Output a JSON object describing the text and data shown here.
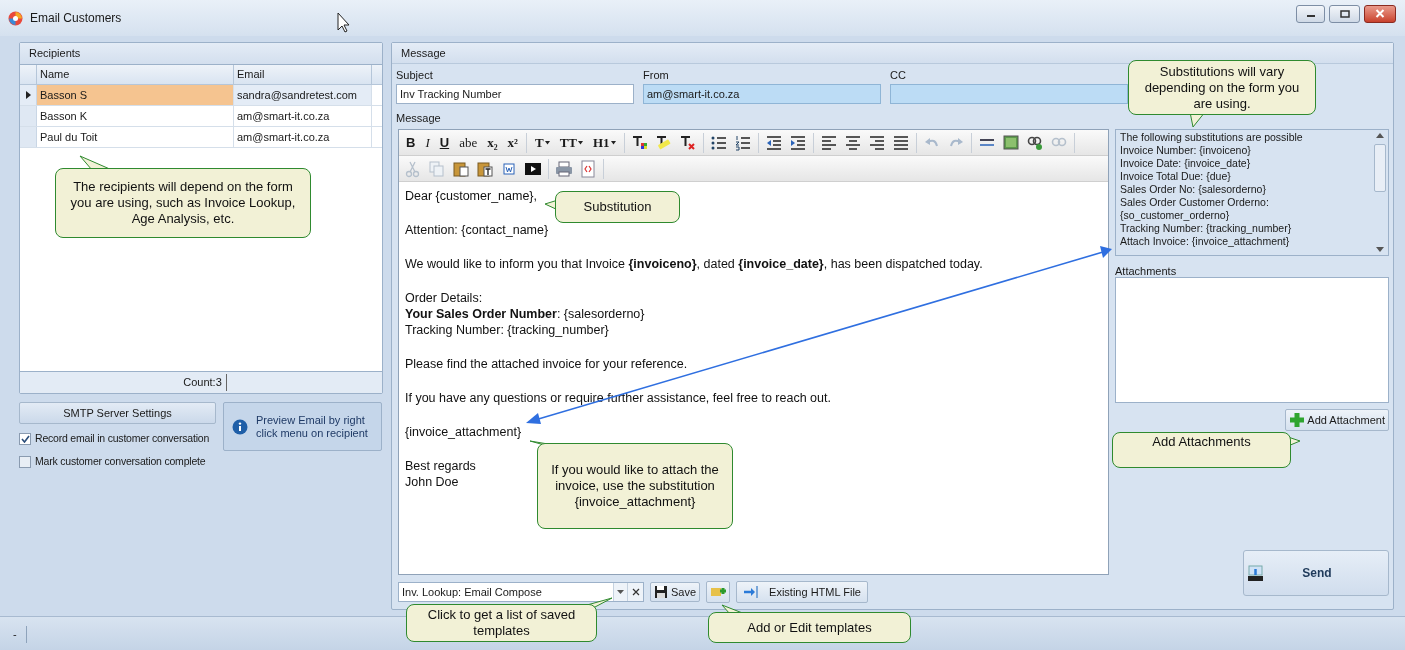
{
  "window": {
    "title": "Email Customers"
  },
  "recipients": {
    "title": "Recipients",
    "columns": [
      "Name",
      "Email"
    ],
    "rows": [
      {
        "name": "Basson S",
        "email": "sandra@sandretest.com",
        "selected": true
      },
      {
        "name": "Basson K",
        "email": "am@smart-it.co.za",
        "selected": false
      },
      {
        "name": "Paul du Toit",
        "email": "am@smart-it.co.za",
        "selected": false
      }
    ],
    "count": "Count:3"
  },
  "smtp_button": "SMTP Server Settings",
  "preview_button": "Preview Email by right click menu on recipient",
  "options": [
    {
      "label": "Record email in customer conversation",
      "checked": true
    },
    {
      "label": "Mark customer conversation complete",
      "checked": false
    }
  ],
  "message": {
    "title": "Message",
    "fields": [
      {
        "label": "Subject",
        "value": "Inv Tracking Number",
        "readonly": false
      },
      {
        "label": "From",
        "value": "am@smart-it.co.za",
        "readonly": true
      },
      {
        "label": "CC",
        "readonly": true
      }
    ],
    "body_label": "Message",
    "format_buttons": [
      {
        "label": "B",
        "kind": "bold"
      },
      {
        "label": "I",
        "kind": "italic"
      },
      {
        "label": "U",
        "kind": "underline"
      },
      {
        "label": "abe",
        "kind": "strike"
      },
      {
        "label": "x₂",
        "kind": "plain"
      },
      {
        "label": "x²",
        "kind": "plain"
      },
      {
        "label": "T",
        "kind": "dropdown"
      },
      {
        "label": "TT",
        "kind": "dropdown"
      },
      {
        "label": "H1",
        "kind": "dropdown"
      }
    ],
    "body": [
      [
        "Dear {customer_name},"
      ],
      [
        "Attention: {contact_name}"
      ],
      [
        "We would like to inform you that Invoice **{invoiceno}**, dated **{invoice_date}**, has been dispatched today."
      ],
      [
        "Order Details:",
        "**Your Sales Order Number**: {salesorderno}",
        "Tracking Number: {tracking_number}"
      ],
      [
        "Please find the attached invoice for your reference."
      ],
      [
        "If you have any questions or require further assistance, feel free to reach out."
      ],
      [
        "{invoice_attachment}"
      ],
      [
        "Best regards",
        "John Doe"
      ]
    ],
    "template": "Inv. Lookup: Email Compose",
    "save_button": "Save",
    "html_button": "Existing HTML File",
    "substitutions": [
      "The following substitutions are possible",
      "Invoice Number: {invoiceno}",
      "Invoice Date: {invoice_date}",
      "Invoice Total Due: {due}",
      "Sales Order No: {salesorderno}",
      "Sales Order Customer Orderno:",
      "{so_customer_orderno}",
      "Tracking Number: {tracking_number}",
      "Attach Invoice: {invoice_attachment}"
    ],
    "attachments_label": "Attachments",
    "add_attachment_button": "Add Attachment",
    "send_button": "Send"
  },
  "callouts": [
    {
      "text": "The recipients will depend on the form you are using, such as Invoice Lookup, Age Analysis, etc."
    },
    {
      "text": "Substitution"
    },
    {
      "text": "Substitutions will vary depending on the form you are using."
    },
    {
      "text": "If you would like to attach the invoice, use the substitution {invoice_attachment}"
    },
    {
      "text": "Add Attachments"
    },
    {
      "text": "Click to get a list of saved templates"
    },
    {
      "text": "Add or Edit templates"
    }
  ],
  "status_bar": {
    "text": "-"
  }
}
